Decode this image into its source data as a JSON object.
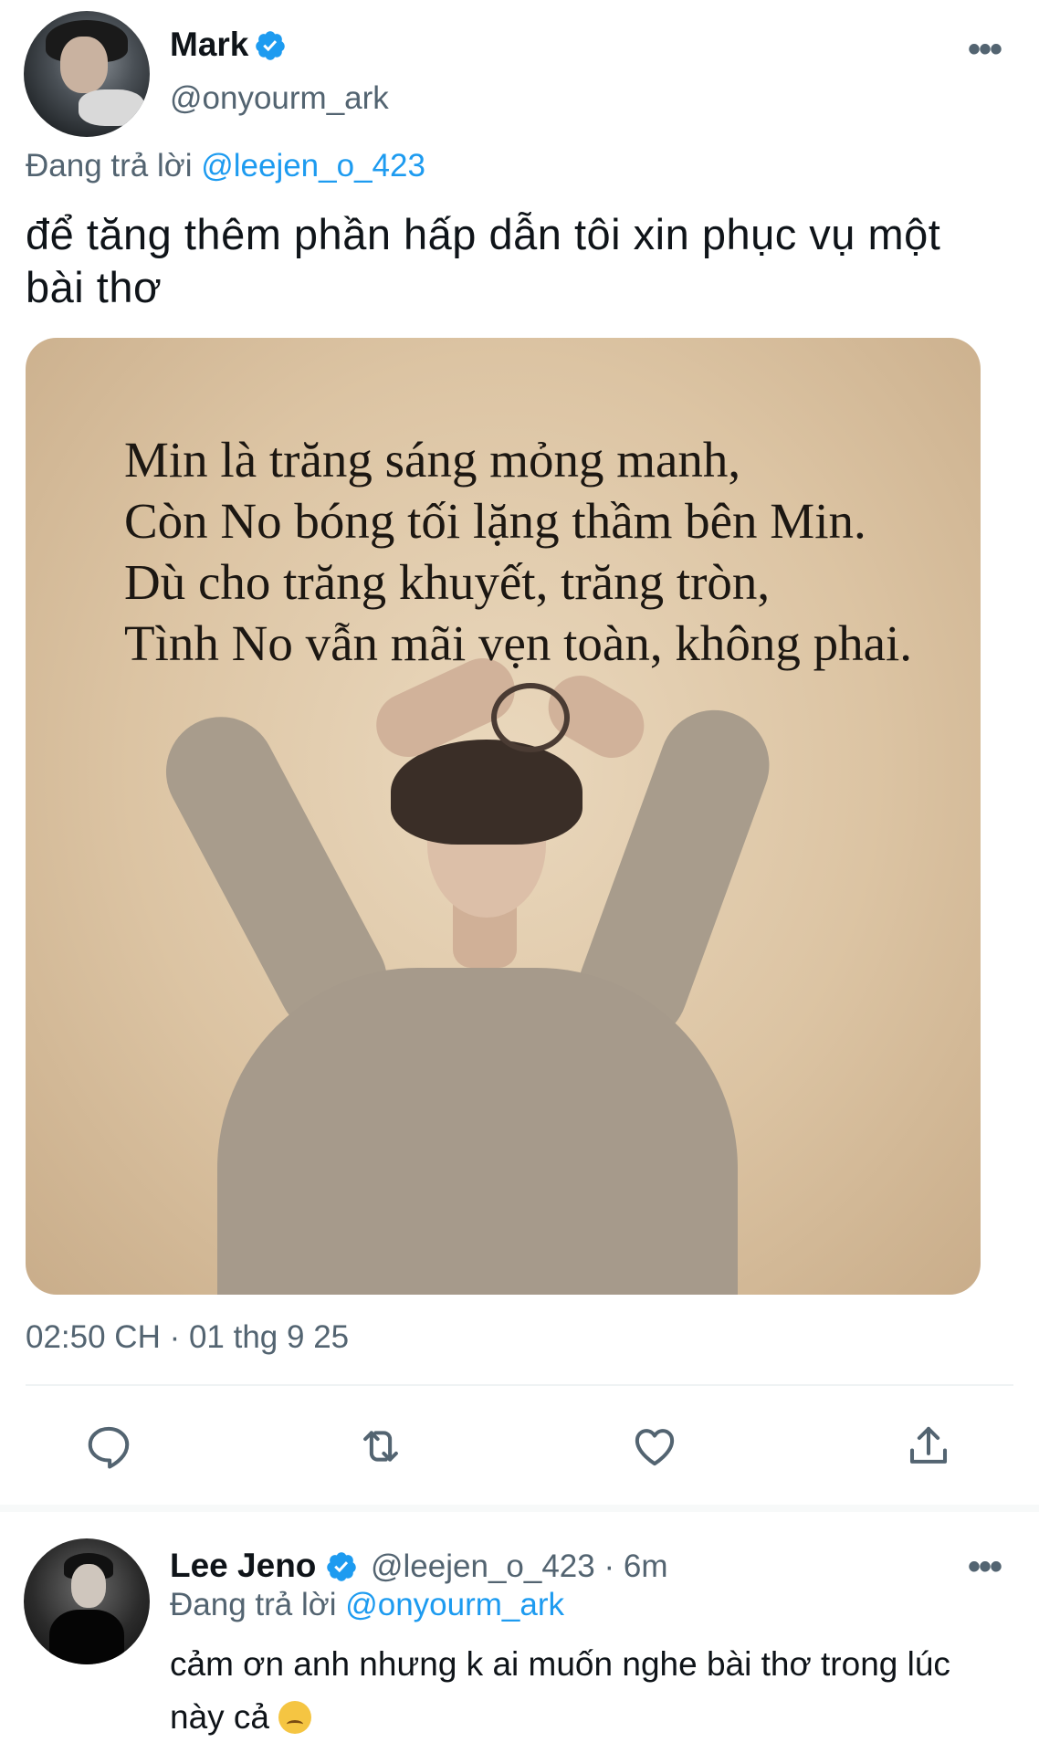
{
  "tweet": {
    "author_name": "Mark",
    "author_handle": "@onyourm_ark",
    "reply_prefix": "Đang trả lời",
    "reply_to": "@leejen_o_423",
    "text": "để tăng thêm phần hấp dẫn tôi xin phục vụ một bài thơ",
    "image": {
      "poem": "Min là trăng sáng mỏng manh,\nCòn No bóng tối lặng thầm bên Min.\nDù cho trăng khuyết, trăng tròn,\nTình No vẫn mãi vẹn toàn, không phai."
    },
    "timestamp": "02:50 CH · 01 thg 9 25",
    "actions": [
      "comment-icon",
      "retweet-icon",
      "like-icon",
      "share-icon"
    ]
  },
  "reply": {
    "author_name": "Lee Jeno",
    "author_handle": "@leejen_o_423",
    "time": "· 6m",
    "reply_prefix": "Đang trả lời",
    "reply_to": "@onyourm_ark",
    "text": "cảm ơn anh nhưng k ai muốn nghe bài thơ trong lúc này cả",
    "emoji": "sleepy-face"
  },
  "colors": {
    "link": "#1d9bf0",
    "secondary_text": "#536471",
    "verified": "#1d9bf0"
  }
}
